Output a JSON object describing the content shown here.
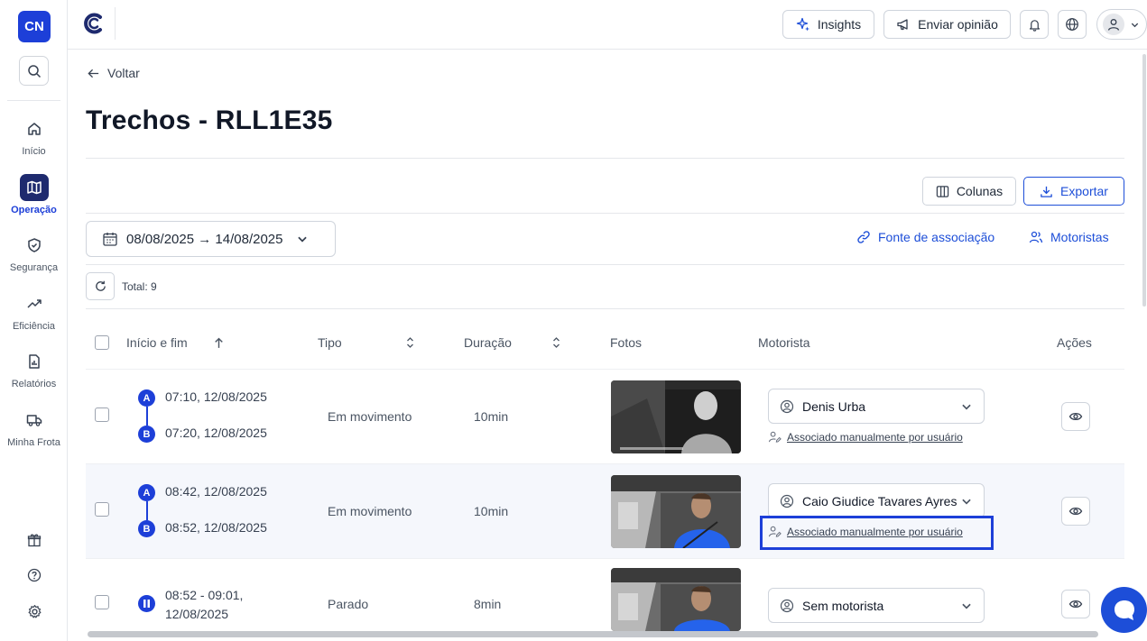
{
  "sidebar": {
    "logo": "CN",
    "items": [
      {
        "label": "Início",
        "icon": "home-icon"
      },
      {
        "label": "Operação",
        "icon": "map-icon"
      },
      {
        "label": "Segurança",
        "icon": "shield-icon"
      },
      {
        "label": "Eficiência",
        "icon": "trend-icon"
      },
      {
        "label": "Relatórios",
        "icon": "report-icon"
      },
      {
        "label": "Minha Frota",
        "icon": "truck-icon"
      }
    ]
  },
  "topbar": {
    "insights_label": "Insights",
    "feedback_label": "Enviar opinião"
  },
  "page": {
    "back_label": "Voltar",
    "title": "Trechos - RLL1E35",
    "columns_label": "Colunas",
    "export_label": "Exportar",
    "date_range": "08/08/2025 → 14/08/2025",
    "source_link": "Fonte de associação",
    "drivers_link": "Motoristas",
    "total": "Total: 9"
  },
  "table": {
    "headers": {
      "start_end": "Início e fim",
      "type": "Tipo",
      "duration": "Duração",
      "photos": "Fotos",
      "driver": "Motorista",
      "actions": "Ações"
    },
    "rows": [
      {
        "point_a": "A",
        "start": "07:10, 12/08/2025",
        "point_b": "B",
        "end": "07:20, 12/08/2025",
        "type": "Em movimento",
        "duration": "10min",
        "driver": "Denis Urba",
        "assoc": "Associado manualmente por usuário"
      },
      {
        "point_a": "A",
        "start": "08:42, 12/08/2025",
        "point_b": "B",
        "end": "08:52, 12/08/2025",
        "type": "Em movimento",
        "duration": "10min",
        "driver": "Caio Giudice Tavares Ayres",
        "assoc": "Associado manualmente por usuário"
      },
      {
        "time_line1": "08:52 - 09:01,",
        "time_line2": "12/08/2025",
        "type": "Parado",
        "duration": "8min",
        "driver": "Sem motorista"
      }
    ]
  },
  "colors": {
    "accent": "#1d3fd8",
    "link": "#1d4ed8",
    "row_alt": "#f5f7fc"
  }
}
